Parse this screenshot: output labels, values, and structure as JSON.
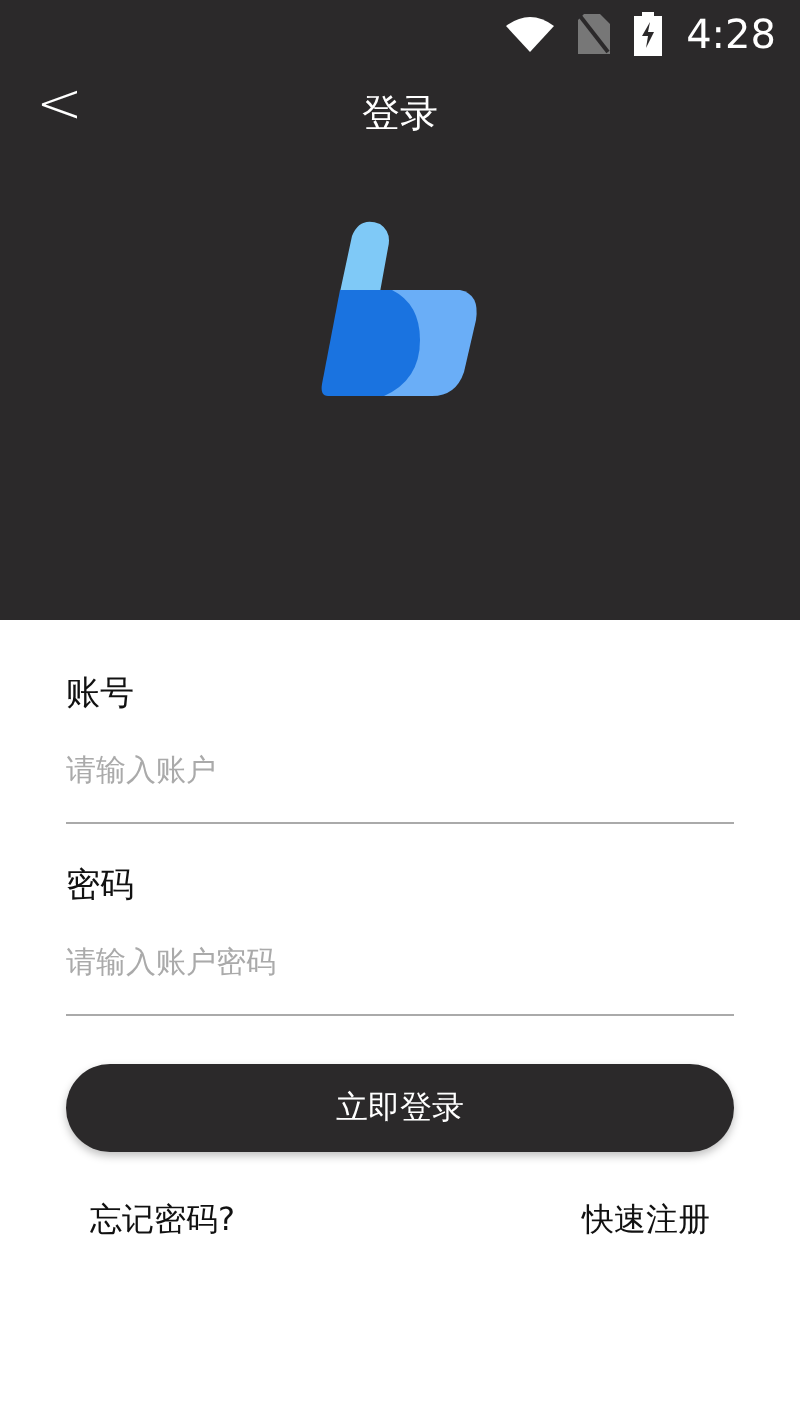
{
  "status_bar": {
    "time": "4:28"
  },
  "header": {
    "back": "<",
    "title": "登录"
  },
  "fields": [
    {
      "label": "账号",
      "placeholder": "请输入账户"
    },
    {
      "label": "密码",
      "placeholder": "请输入账户密码"
    }
  ],
  "login_button": "立即登录",
  "links": [
    "忘记密码?",
    "快速注册"
  ]
}
